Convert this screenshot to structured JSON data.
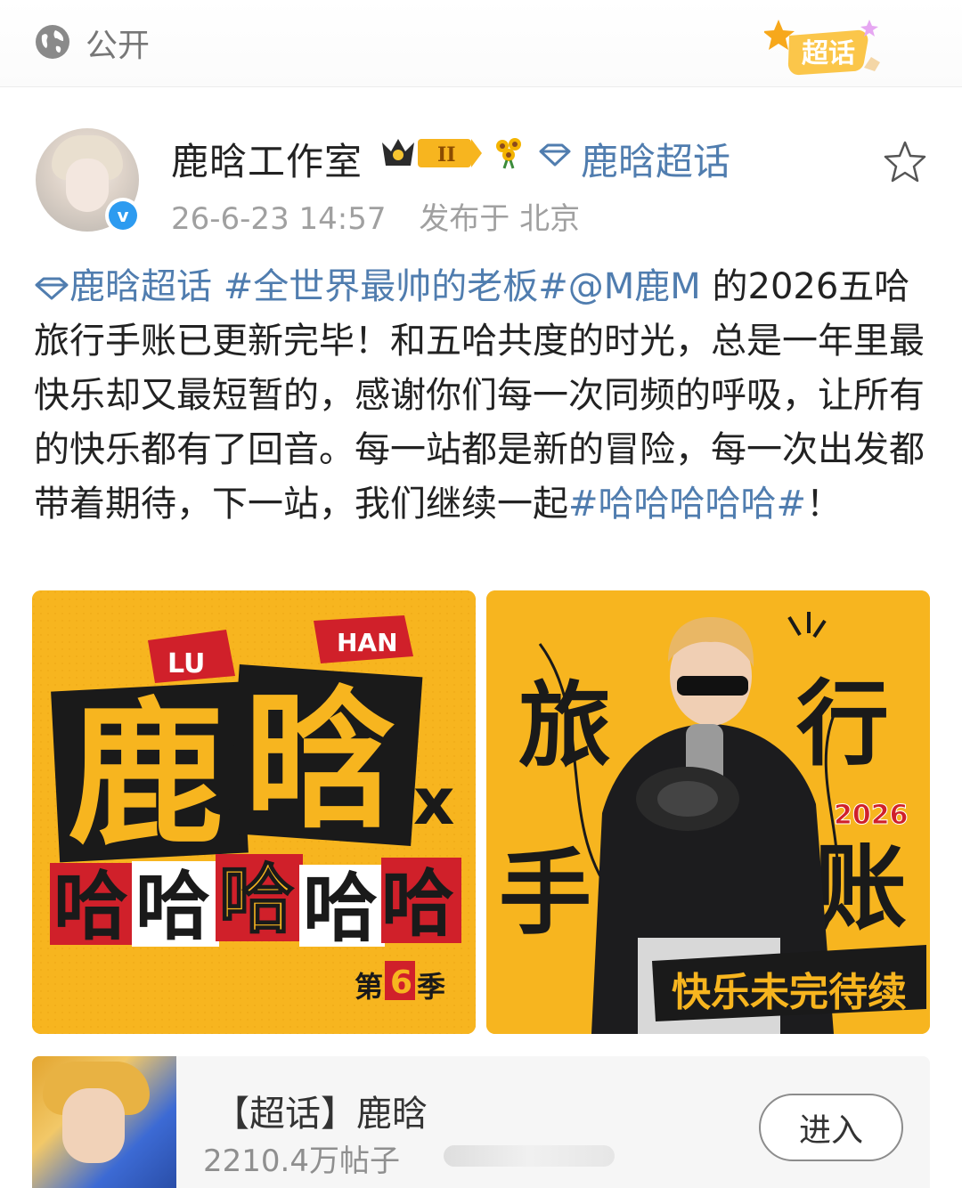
{
  "topbar": {
    "visibility": "公开",
    "badge_label": "超话"
  },
  "author": {
    "name": "鹿晗工作室",
    "crown_level": "II",
    "topic_name": "鹿晗超话",
    "timestamp": "26-6-23 14:57",
    "location": "发布于 北京",
    "verified_mark": "v"
  },
  "post": {
    "segments": [
      {
        "text": "鹿晗超话 ",
        "type": "link"
      },
      {
        "text": "#全世界最帅的老板#",
        "type": "link"
      },
      {
        "text": "@M鹿M",
        "type": "link"
      },
      {
        "text": " 的2026五哈旅行手账已更新完毕！和五哈共度的时光，总是一年里最快乐却又最短暂的，感谢你们每一次同频的呼吸，让所有的快乐都有了回音。每一站都是新的冒险，每一次出发都带着期待，下一站，我们继续一起",
        "type": "text"
      },
      {
        "text": "#哈哈哈哈哈#",
        "type": "link"
      },
      {
        "text": "！",
        "type": "text"
      }
    ]
  },
  "images": {
    "left": {
      "tag_lu": "LU",
      "tag_han": "HAN",
      "main_1": "鹿",
      "main_2": "晗",
      "x_mark": "x",
      "ha_1": "哈",
      "ha_2": "哈",
      "ha_3": "哈",
      "ha_4": "哈",
      "ha_5": "哈",
      "season_1": "第",
      "season_num": "6",
      "season_2": "季"
    },
    "right": {
      "char_1": "旅",
      "char_2": "行",
      "char_3": "手",
      "char_4": "账",
      "year": "2026",
      "banner": "快乐未完待续"
    }
  },
  "topic_card": {
    "title": "【超话】鹿晗",
    "count": "2210.4万帖子",
    "enter_label": "进入"
  },
  "colors": {
    "link": "#507daf",
    "poster_bg": "#f7b51f",
    "accent_red": "#d0202a"
  }
}
